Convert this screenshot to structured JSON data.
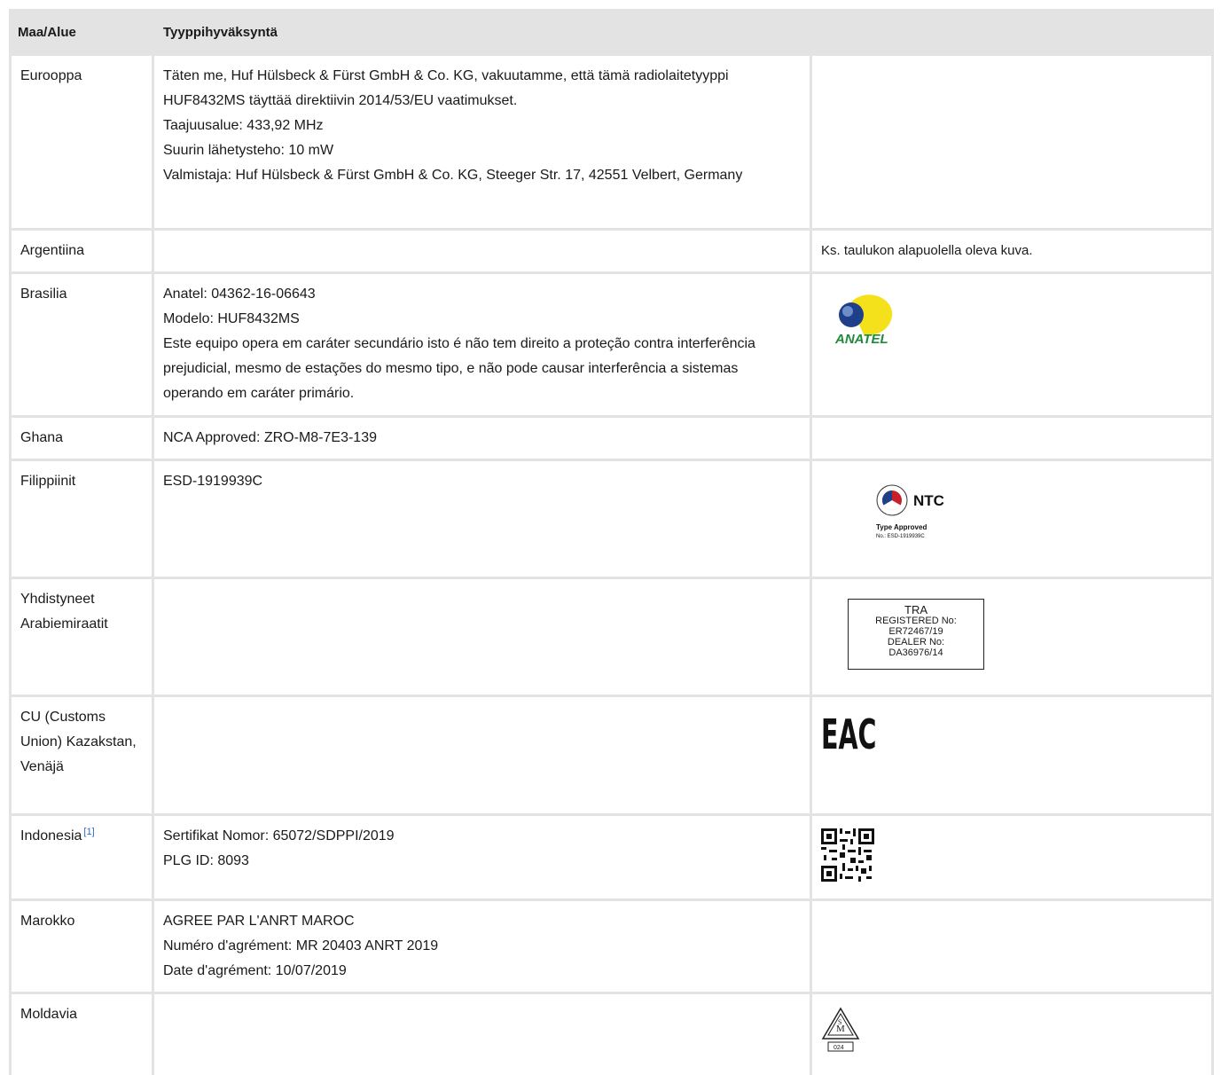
{
  "table": {
    "headers": [
      "Maa/Alue",
      "Tyyppihyväksyntä"
    ],
    "rows": [
      {
        "country": "Eurooppa",
        "lines": [
          "Täten me, Huf Hülsbeck & Fürst GmbH & Co. KG, vakuutamme, että tämä radiolaitetyyppi HUF8432MS täyttää direktiivin 2014/53/EU vaatimukset.",
          "Taajuusalue: 433,92 MHz",
          "Suurin lähetysteho: 10 mW",
          "Valmistaja: Huf Hülsbeck & Fürst GmbH & Co. KG, Steeger Str. 17, 42551 Velbert, Germany"
        ],
        "note": ""
      },
      {
        "country": "Argentiina",
        "lines": [],
        "note": "Ks. taulukon alapuolella oleva kuva."
      },
      {
        "country": "Brasilia",
        "lines": [
          "Anatel: 04362-16-06643",
          "Modelo: HUF8432MS",
          "Este equipo opera em caráter secundário isto é não tem direito a proteção contra interferência prejudicial, mesmo de estações do mesmo tipo, e não pode causar interferência a sistemas operando em caráter primário."
        ],
        "logo_text": "ANATEL"
      },
      {
        "country": "Ghana",
        "lines": [
          "NCA Approved: ZRO-M8-7E3-139"
        ]
      },
      {
        "country": "Filippiinit",
        "lines": [
          "ESD-1919939C"
        ],
        "logo": {
          "brand": "NTC",
          "line1": "Type Approved",
          "line2": "No.: ESD-1919939C"
        }
      },
      {
        "country": "Yhdistyneet Arabiemiraatit",
        "lines": [],
        "logo": [
          "TRA",
          "REGISTERED No:",
          "ER72467/19",
          "DEALER No:",
          "DA36976/14"
        ]
      },
      {
        "country": "CU (Customs Union) Kazakstan, Venäjä",
        "lines": [],
        "logo_text": "EAC"
      },
      {
        "country": "Indonesia",
        "footnote": "[1]",
        "lines": [
          "Sertifikat Nomor: 65072/SDPPI/2019",
          "PLG ID: 8093"
        ],
        "logo_icon": "qr-code-icon"
      },
      {
        "country": "Marokko",
        "lines": [
          "AGREE PAR L'ANRT MAROC",
          "Numéro d'agrément: MR 20403 ANRT 2019",
          "Date d'agrément: 10/07/2019"
        ]
      },
      {
        "country": "Moldavia",
        "lines": [],
        "logo_text": "024"
      }
    ]
  }
}
